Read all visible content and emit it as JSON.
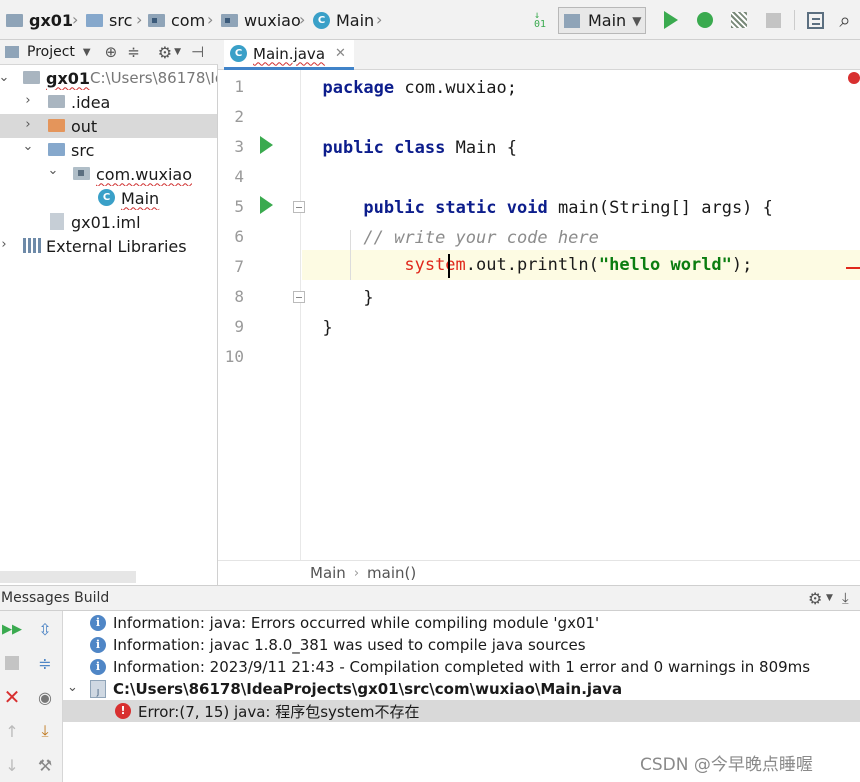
{
  "navbar": {
    "breadcrumbs": [
      "gx01",
      "src",
      "com",
      "wuxiao",
      "Main"
    ],
    "run_config": "Main"
  },
  "project": {
    "header_label": "Project",
    "tree": [
      {
        "label": "gx01",
        "sub": "C:\\Users\\86178\\Id"
      },
      {
        "label": ".idea"
      },
      {
        "label": "out"
      },
      {
        "label": "src"
      },
      {
        "label": "com.wuxiao"
      },
      {
        "label": "Main"
      },
      {
        "label": "gx01.iml"
      },
      {
        "label": "External Libraries"
      }
    ]
  },
  "editor": {
    "tab_label": "Main.java",
    "line_numbers": [
      "1",
      "2",
      "3",
      "4",
      "5",
      "6",
      "7",
      "8",
      "9",
      "10"
    ],
    "code": {
      "l1_kw": "package",
      "l1_rest": " com.wuxiao;",
      "l3_kw1": "public",
      "l3_kw2": "class",
      "l3_rest": " Main {",
      "l5_kw1": "public",
      "l5_kw2": "static",
      "l5_kw3": "void",
      "l5_rest": " main(String[] args) {",
      "l6_comment": "// write your code here",
      "l7_err": "system",
      "l7_mid": ".out.println(",
      "l7_str": "\"hello world\"",
      "l7_end": ");",
      "l8": "}",
      "l9": "}"
    },
    "breadcrumb": [
      "Main",
      "main()"
    ]
  },
  "messages": {
    "header": "Messages Build",
    "rows": [
      "Information: java: Errors occurred while compiling module 'gx01'",
      "Information: javac 1.8.0_381 was used to compile java sources",
      "Information: 2023/9/11 21:43 - Compilation completed with 1 error and 0 warnings in 809ms",
      "C:\\Users\\86178\\IdeaProjects\\gx01\\src\\com\\wuxiao\\Main.java",
      "Error:(7, 15)  java: 程序包system不存在"
    ]
  },
  "watermark": "CSDN @今早晚点睡喔",
  "colors": {
    "keyword": "#0c1d8c",
    "string": "#0b7d10",
    "error": "#e0281c",
    "run": "#3aaa4f",
    "selection": "#d9d9d9"
  }
}
